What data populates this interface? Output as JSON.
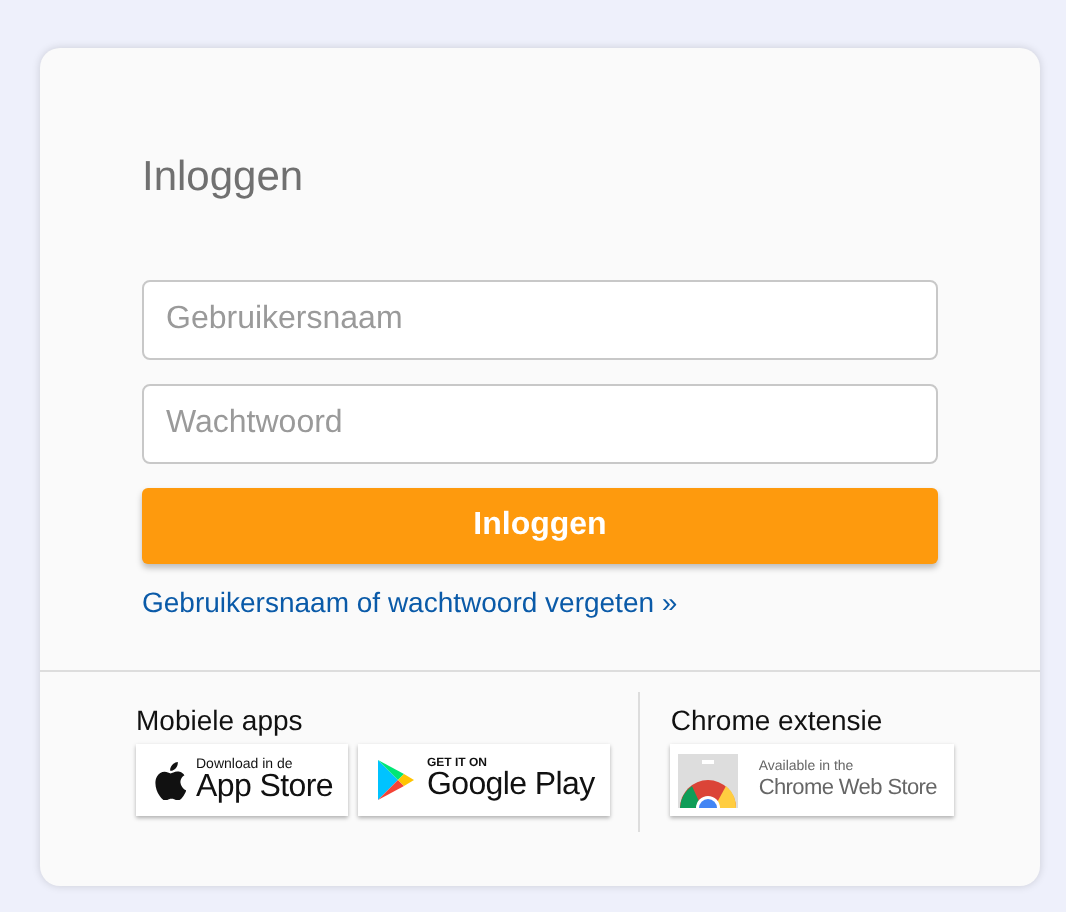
{
  "title": "Inloggen",
  "fields": [
    {
      "placeholder": "Gebruikersnaam"
    },
    {
      "placeholder": "Wachtwoord"
    }
  ],
  "submit": "Inloggen",
  "forgot_link": "Gebruikersnaam of wachtwoord vergeten »",
  "footer": [
    {
      "heading": "Mobiele apps",
      "badges": [
        {
          "kind": "apple",
          "small": "Download in de",
          "big": "App Store"
        },
        {
          "kind": "google",
          "small": "GET IT ON",
          "big": "Google Play"
        }
      ]
    },
    {
      "heading": "Chrome extensie",
      "badges": [
        {
          "kind": "chrome",
          "small": "Available in the",
          "big": "Chrome Web Store"
        }
      ]
    }
  ]
}
